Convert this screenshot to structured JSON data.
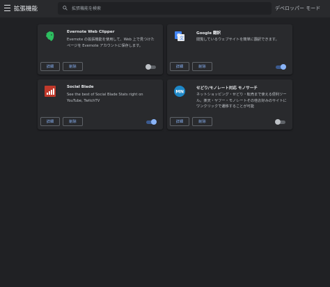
{
  "toolbar": {
    "menu_icon": "hamburger-icon",
    "title": "拡張機能",
    "search_placeholder": "拡張機能を検索",
    "search_icon": "search-icon",
    "dev_mode_label": "デベロッパー モード"
  },
  "extensions": [
    {
      "name": "Evernote Web Clipper",
      "description": "Evernote の拡張機能を使用して、Web 上で見つけたページを Evernote アカウントに保存します。",
      "icon": "evernote-elephant-icon",
      "details_label": "詳細",
      "remove_label": "削除",
      "enabled": false
    },
    {
      "name": "Google 翻訳",
      "description": "閲覧しているウェブサイトを簡単に翻訳できます。",
      "icon": "google-translate-icon",
      "details_label": "詳細",
      "remove_label": "削除",
      "enabled": true
    },
    {
      "name": "Social Blade",
      "description": "See the best of Social Blade Stats right on YouTube, TwitchTV",
      "icon": "social-blade-icon",
      "details_label": "詳細",
      "remove_label": "削除",
      "enabled": true
    },
    {
      "name": "せどり/モノレート対応 モノサーチ",
      "description": "ネットショッピング・せどり・転売まで使える便利ツール。楽天・ヤフー・モノレートその他お好みのサイトにワンクリックで遷移することが可能",
      "icon": "monosearch-icon",
      "details_label": "詳細",
      "remove_label": "削除",
      "enabled": false
    }
  ],
  "colors": {
    "background": "#202124",
    "toolbar": "#292a2d",
    "card": "#292a2d",
    "accent": "#8ab4f8"
  }
}
